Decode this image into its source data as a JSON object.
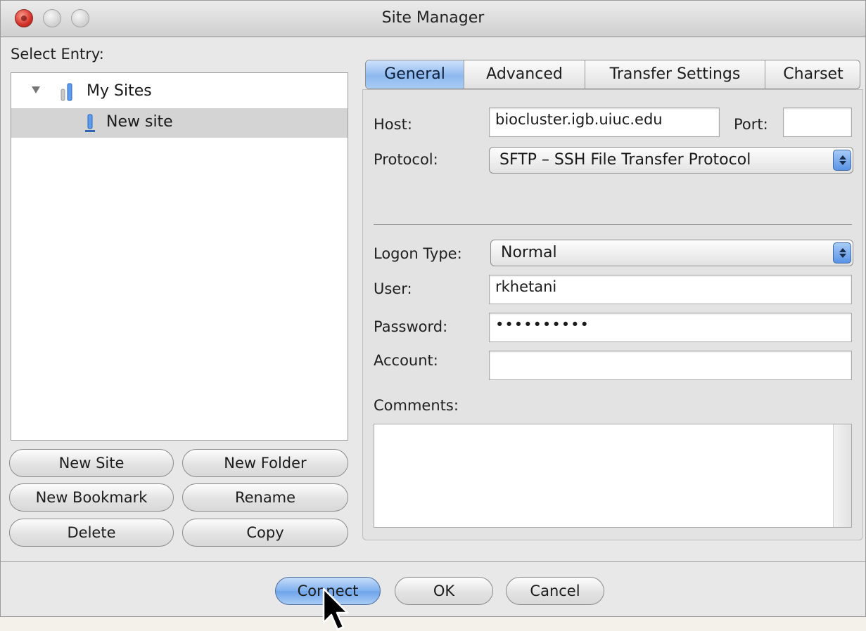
{
  "window": {
    "title": "Site Manager"
  },
  "left": {
    "select_entry_label": "Select Entry:",
    "tree": {
      "root": "My Sites",
      "child": "New site"
    },
    "buttons": {
      "new_site": "New Site",
      "new_folder": "New Folder",
      "new_bookmark": "New Bookmark",
      "rename": "Rename",
      "delete": "Delete",
      "copy": "Copy"
    }
  },
  "tabs": [
    "General",
    "Advanced",
    "Transfer Settings",
    "Charset"
  ],
  "general": {
    "host_label": "Host:",
    "host_value": "biocluster.igb.uiuc.edu",
    "port_label": "Port:",
    "port_value": "",
    "protocol_label": "Protocol:",
    "protocol_value": "SFTP – SSH File Transfer Protocol",
    "logon_type_label": "Logon Type:",
    "logon_type_value": "Normal",
    "user_label": "User:",
    "user_value": "rkhetani",
    "password_label": "Password:",
    "password_value": "••••••••••",
    "account_label": "Account:",
    "account_value": "",
    "comments_label": "Comments:",
    "comments_value": ""
  },
  "footer": {
    "connect": "Connect",
    "ok": "OK",
    "cancel": "Cancel"
  },
  "colors": {
    "accent": "#7fb0ee",
    "close_button": "#d2322a"
  },
  "icons": [
    "close-icon",
    "minimize-icon",
    "maximize-icon",
    "disclosure-triangle-icon",
    "sites-folder-icon",
    "site-icon",
    "stepper-icon",
    "mouse-cursor-icon"
  ]
}
